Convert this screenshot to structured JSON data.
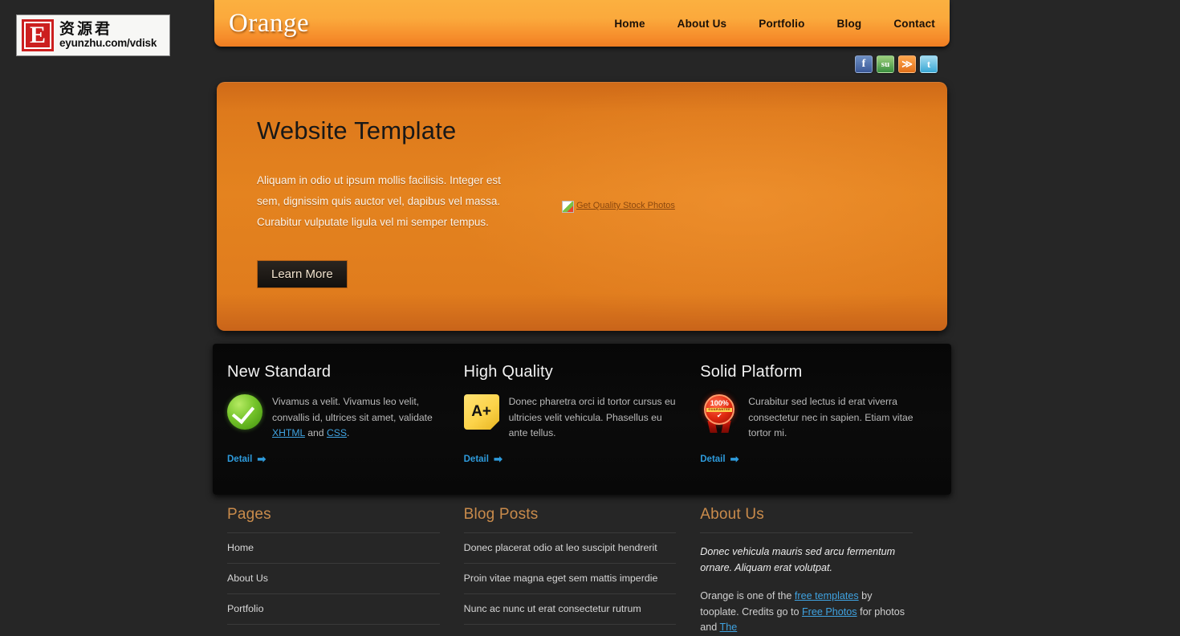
{
  "watermark": {
    "letter": "E",
    "cn_text": "资源君",
    "url": "eyunzhu.com/vdisk"
  },
  "header": {
    "logo": "Orange",
    "nav": [
      {
        "label": "Home"
      },
      {
        "label": "About Us"
      },
      {
        "label": "Portfolio"
      },
      {
        "label": "Blog"
      },
      {
        "label": "Contact"
      }
    ]
  },
  "social": [
    {
      "name": "facebook-icon",
      "glyph": "f",
      "color": "#3b5998"
    },
    {
      "name": "stumbleupon-icon",
      "glyph": "su",
      "color": "#3b8f3f"
    },
    {
      "name": "rss-icon",
      "glyph": "≫",
      "color": "#e2701a"
    },
    {
      "name": "twitter-icon",
      "glyph": "t",
      "color": "#3aa8d6"
    }
  ],
  "banner": {
    "title": "Website Template",
    "paragraph": "Aliquam in odio ut ipsum mollis facilisis. Integer est sem, dignissim quis auctor vel, dapibus vel massa. Curabitur vulputate ligula vel mi semper tempus.",
    "button": "Learn More",
    "broken_image_alt": "Get Quality Stock Photos"
  },
  "features": [
    {
      "title": "New Standard",
      "icon": "green-check-icon",
      "text_before": "Vivamus a velit. Vivamus leo velit, convallis id, ultrices sit amet, validate ",
      "link1": "XHTML",
      "text_mid": " and ",
      "link2": "CSS",
      "text_after": ".",
      "detail": "Detail"
    },
    {
      "title": "High Quality",
      "icon": "a-plus-note-icon",
      "text_before": "Donec pharetra orci id tortor cursus eu ultricies velit vehicula. Phasellus eu ante tellus.",
      "link1": "",
      "text_mid": "",
      "link2": "",
      "text_after": "",
      "detail": "Detail"
    },
    {
      "title": "Solid Platform",
      "icon": "guarantee-badge-icon",
      "badge_percent": "100%",
      "badge_label": "GUARANTEE",
      "text_before": "Curabitur sed lectus id erat viverra consectetur nec in sapien. Etiam vitae tortor mi.",
      "link1": "",
      "text_mid": "",
      "link2": "",
      "text_after": "",
      "detail": "Detail"
    }
  ],
  "footer": {
    "pages": {
      "title": "Pages",
      "items": [
        {
          "label": "Home"
        },
        {
          "label": "About Us"
        },
        {
          "label": "Portfolio"
        }
      ]
    },
    "blog": {
      "title": "Blog Posts",
      "items": [
        {
          "label": "Donec placerat odio at leo suscipit hendrerit"
        },
        {
          "label": "Proin vitae magna eget sem mattis imperdie"
        },
        {
          "label": "Nunc ac nunc ut erat consectetur rutrum"
        }
      ]
    },
    "about": {
      "title": "About Us",
      "italic": "Donec vehicula mauris sed arcu fermentum ornare. Aliquam erat volutpat.",
      "p_1": "Orange is one of the ",
      "link_templates": "free templates",
      "p_2": " by tooplate. Credits go to ",
      "link_photos": "Free Photos",
      "p_3": " for photos and ",
      "link_the": "The"
    }
  },
  "colors": {
    "page_bg": "#262626",
    "accent_orange": "#e4831f",
    "header_top": "#fbb040",
    "header_bottom": "#ef7d22",
    "link_blue": "#3fa2e0",
    "footer_heading": "#c98b4b"
  }
}
